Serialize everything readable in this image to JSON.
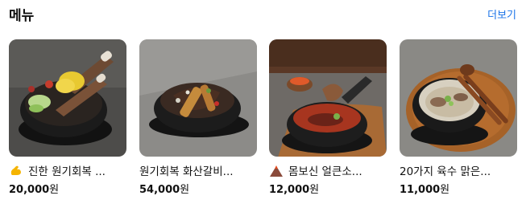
{
  "header": {
    "title": "메뉴",
    "more_label": "더보기"
  },
  "menu_items": [
    {
      "name": "진한 원기회복 ...",
      "price": "20,000",
      "currency": "원",
      "icon": "flexed-biceps-icon"
    },
    {
      "name": "원기회복 화산갈비...",
      "price": "54,000",
      "currency": "원"
    },
    {
      "name": "몸보신 얼큰소...",
      "price": "12,000",
      "currency": "원",
      "icon": "volcano-icon"
    },
    {
      "name": "20가지 육수 맑은...",
      "price": "11,000",
      "currency": "원"
    }
  ]
}
